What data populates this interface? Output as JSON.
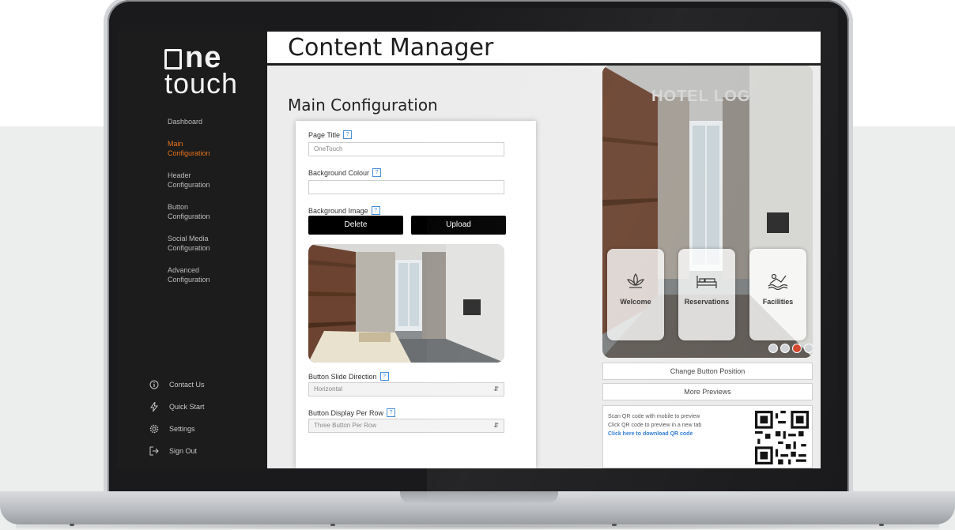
{
  "app": {
    "logo_line1": "ne",
    "logo_line2": "touch"
  },
  "sidebar": {
    "items": [
      {
        "label": "Dashboard",
        "active": false
      },
      {
        "label": "Main Configuration",
        "active": true
      },
      {
        "label": "Header Configuration",
        "active": false
      },
      {
        "label": "Button Configuration",
        "active": false
      },
      {
        "label": "Social Media Configuration",
        "active": false
      },
      {
        "label": "Advanced Configuration",
        "active": false
      }
    ],
    "bottom_items": [
      {
        "label": "Contact Us",
        "icon": "info-icon"
      },
      {
        "label": "Quick Start",
        "icon": "bolt-icon"
      },
      {
        "label": "Settings",
        "icon": "gear-icon"
      },
      {
        "label": "Sign Out",
        "icon": "sign-out-icon"
      }
    ]
  },
  "header": {
    "title": "Content Manager"
  },
  "main": {
    "section_title": "Main Configuration",
    "page_title_label": "Page Title",
    "page_title_value": "OneTouch",
    "bg_colour_label": "Background Colour",
    "bg_colour_value": "",
    "bg_image_label": "Background Image",
    "delete_label": "Delete",
    "upload_label": "Upload",
    "slide_direction_label": "Button Slide Direction",
    "slide_direction_value": "Horizontal",
    "display_per_row_label": "Button Display Per Row",
    "display_per_row_value": "Three Button Per Row"
  },
  "preview": {
    "hotel_logo": "HOTEL LOGO",
    "tiles": [
      {
        "label": "Welcome",
        "icon": "lotus-icon"
      },
      {
        "label": "Reservations",
        "icon": "bed-icon"
      },
      {
        "label": "Facilities",
        "icon": "pool-icon"
      }
    ],
    "change_position_label": "Change Button Position",
    "more_previews_label": "More Previews",
    "qr_line1": "Scan QR code with mobile to preview",
    "qr_line2": "Click QR code to preview in a new tab",
    "qr_link": "Click here to download QR code"
  },
  "colors": {
    "accent": "#e8731a",
    "sidebar_bg": "#1c1c1c",
    "help_blue": "#4a8fd8"
  }
}
